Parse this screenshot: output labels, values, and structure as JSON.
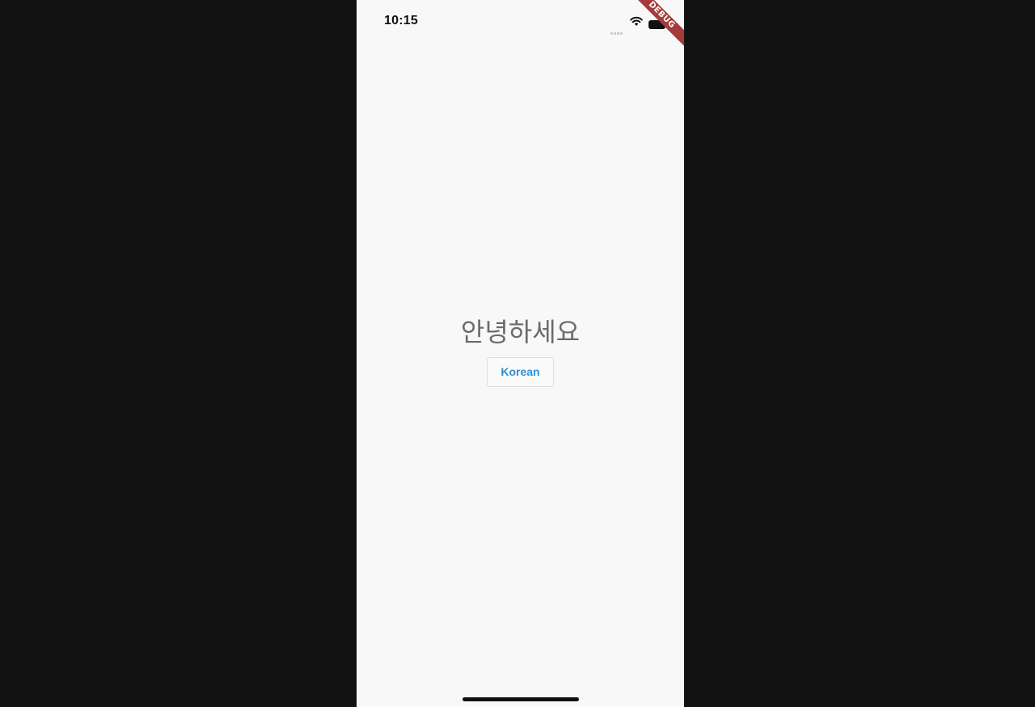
{
  "status_bar": {
    "time": "10:15",
    "icons": [
      "cellular-signal-icon",
      "wifi-icon",
      "battery-icon"
    ]
  },
  "debug_banner": {
    "label": "DEBUG",
    "color": "#a63a3a"
  },
  "main": {
    "greeting": "안녕하세요",
    "language_button_label": "Korean"
  },
  "colors": {
    "background": "#f8f8f8",
    "accent": "#2f8fd4",
    "greeting_text": "#6b6b6b"
  }
}
